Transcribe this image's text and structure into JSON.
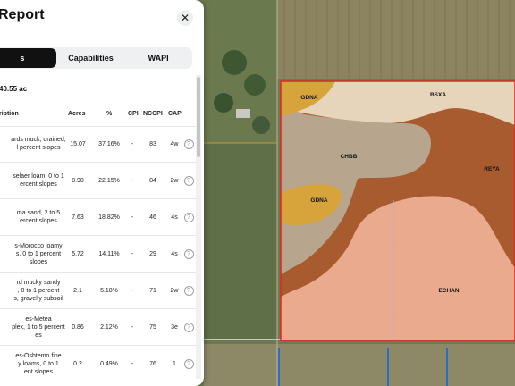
{
  "panel": {
    "title": "Report",
    "close_icon": "close-icon",
    "tabs": [
      {
        "label": "s",
        "active": true
      },
      {
        "label": "Capabilities",
        "active": false
      },
      {
        "label": "WAPI",
        "active": false
      }
    ],
    "total_acres": "40.55 ac",
    "table": {
      "headers": {
        "description": "ription",
        "acres": "Acres",
        "pct": "%",
        "cpi": "CPI",
        "nccpi": "NCCPI",
        "cap": "CAP"
      },
      "rows": [
        {
          "desc1": "ards muck, drained,",
          "desc2": "l percent slopes",
          "acres": "15.07",
          "pct": "37.16%",
          "cpi": "-",
          "nccpi": "83",
          "cap": "4w"
        },
        {
          "desc1": "selaer loam, 0 to 1",
          "desc2": "ercent slopes",
          "acres": "8.98",
          "pct": "22.15%",
          "cpi": "-",
          "nccpi": "84",
          "cap": "2w"
        },
        {
          "desc1": "ma sand, 2 to 5",
          "desc2": "ercent slopes",
          "acres": "7.63",
          "pct": "18.82%",
          "cpi": "-",
          "nccpi": "46",
          "cap": "4s"
        },
        {
          "desc1": "s-Morocco loamy",
          "desc2": "s, 0 to 1 percent",
          "desc3": "slopes",
          "acres": "5.72",
          "pct": "14.11%",
          "cpi": "-",
          "nccpi": "29",
          "cap": "4s"
        },
        {
          "desc1": "rd mucky sandy",
          "desc2": ", 0 to 1 percent",
          "desc3": "s, gravelly subsoil",
          "acres": "2.1",
          "pct": "5.18%",
          "cpi": "-",
          "nccpi": "71",
          "cap": "2w"
        },
        {
          "desc1": "es-Metea",
          "desc2": "plex, 1 to 5 percent",
          "desc3": "es",
          "acres": "0.86",
          "pct": "2.12%",
          "cpi": "-",
          "nccpi": "75",
          "cap": "3e"
        },
        {
          "desc1": "es-Oshtemo fine",
          "desc2": "y loams, 0 to 1",
          "desc3": "ent slopes",
          "acres": "0.2",
          "pct": "0.49%",
          "cpi": "-",
          "nccpi": "76",
          "cap": "1"
        }
      ],
      "help_icon": "question-circle-icon"
    }
  },
  "map": {
    "soil_labels": {
      "gdna_top": "GDNA",
      "bsxa": "BSXA",
      "chbb": "CHBB",
      "gdna_left": "GDNA",
      "reya": "REYA",
      "echan": "ECHAN"
    },
    "boundary_color": "#e52521",
    "soil_colors": {
      "gdna": "#d6a43a",
      "bsxa": "#e6d5bb",
      "chbb": "#b7a58d",
      "reya": "#a85b2e",
      "echan": "#e9aa8e"
    }
  }
}
